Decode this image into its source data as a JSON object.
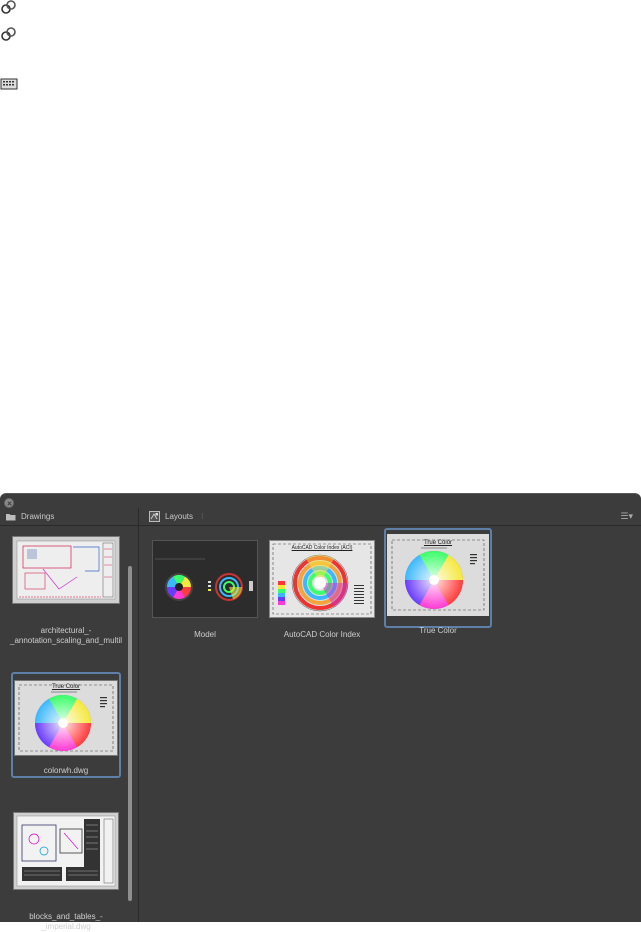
{
  "panel": {
    "drawings_header": "Drawings",
    "layouts_header": "Layouts",
    "drawings": [
      {
        "label": "architectural_-_annotation_scaling_and_multil",
        "selected": false
      },
      {
        "label": "colorwh.dwg",
        "selected": true,
        "thumb_text": "True Color"
      },
      {
        "label": "blocks_and_tables_-_imperial.dwg",
        "selected": false
      }
    ],
    "layouts": [
      {
        "label": "Model",
        "selected": false
      },
      {
        "label": "AutoCAD Color Index",
        "selected": false,
        "thumb_text": "AutoCAD Color Index (ACI)"
      },
      {
        "label": "True Color",
        "selected": true,
        "thumb_text": "True Color"
      }
    ]
  },
  "colors": {
    "panel_bg": "#3c3c3c",
    "selection": "#5e7fa8",
    "text": "#cfcfcf"
  },
  "icons": [
    "linked-rings-icon",
    "linked-rings-icon",
    "keyboard-icon",
    "close-icon",
    "folder-icon",
    "layouts-icon",
    "list-view-icon"
  ]
}
